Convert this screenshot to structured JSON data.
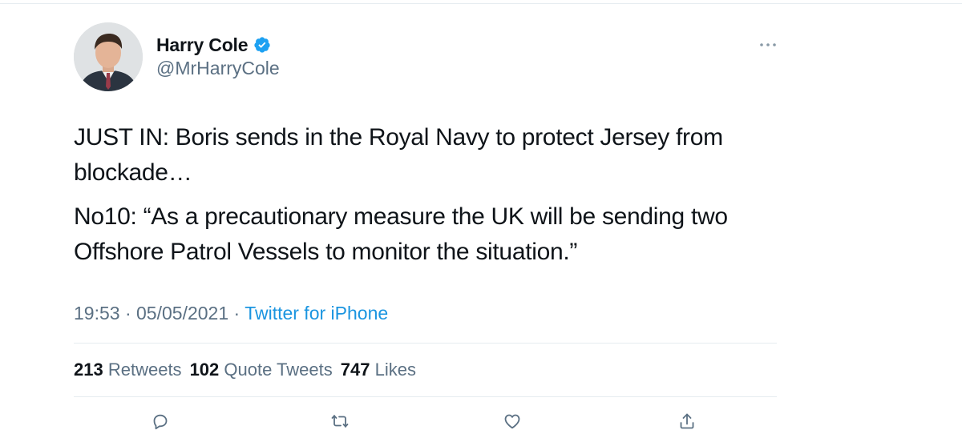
{
  "author": {
    "display_name": "Harry Cole",
    "handle": "@MrHarryCole",
    "verified": true
  },
  "tweet": {
    "paragraphs": [
      "JUST IN: Boris sends in the Royal Navy to protect Jersey from blockade…",
      "No10: “As a precautionary measure the UK will be sending two Offshore Patrol Vessels to monitor the situation.”"
    ],
    "time": "19:53",
    "separator": "·",
    "date": "05/05/2021",
    "source": "Twitter for iPhone"
  },
  "stats": {
    "retweets_count": "213",
    "retweets_label": "Retweets",
    "quote_tweets_count": "102",
    "quote_tweets_label": "Quote Tweets",
    "likes_count": "747",
    "likes_label": "Likes"
  },
  "icons": {
    "verified": "verified-badge-icon",
    "more": "more-icon",
    "reply": "reply-icon",
    "retweet": "retweet-icon",
    "like": "heart-icon",
    "share": "share-icon"
  },
  "colors": {
    "accent": "#1b95e0",
    "verified_badge": "#1da1f2",
    "secondary_text": "#5b7083",
    "primary_text": "#0f1419",
    "divider": "#e6ecf0"
  }
}
